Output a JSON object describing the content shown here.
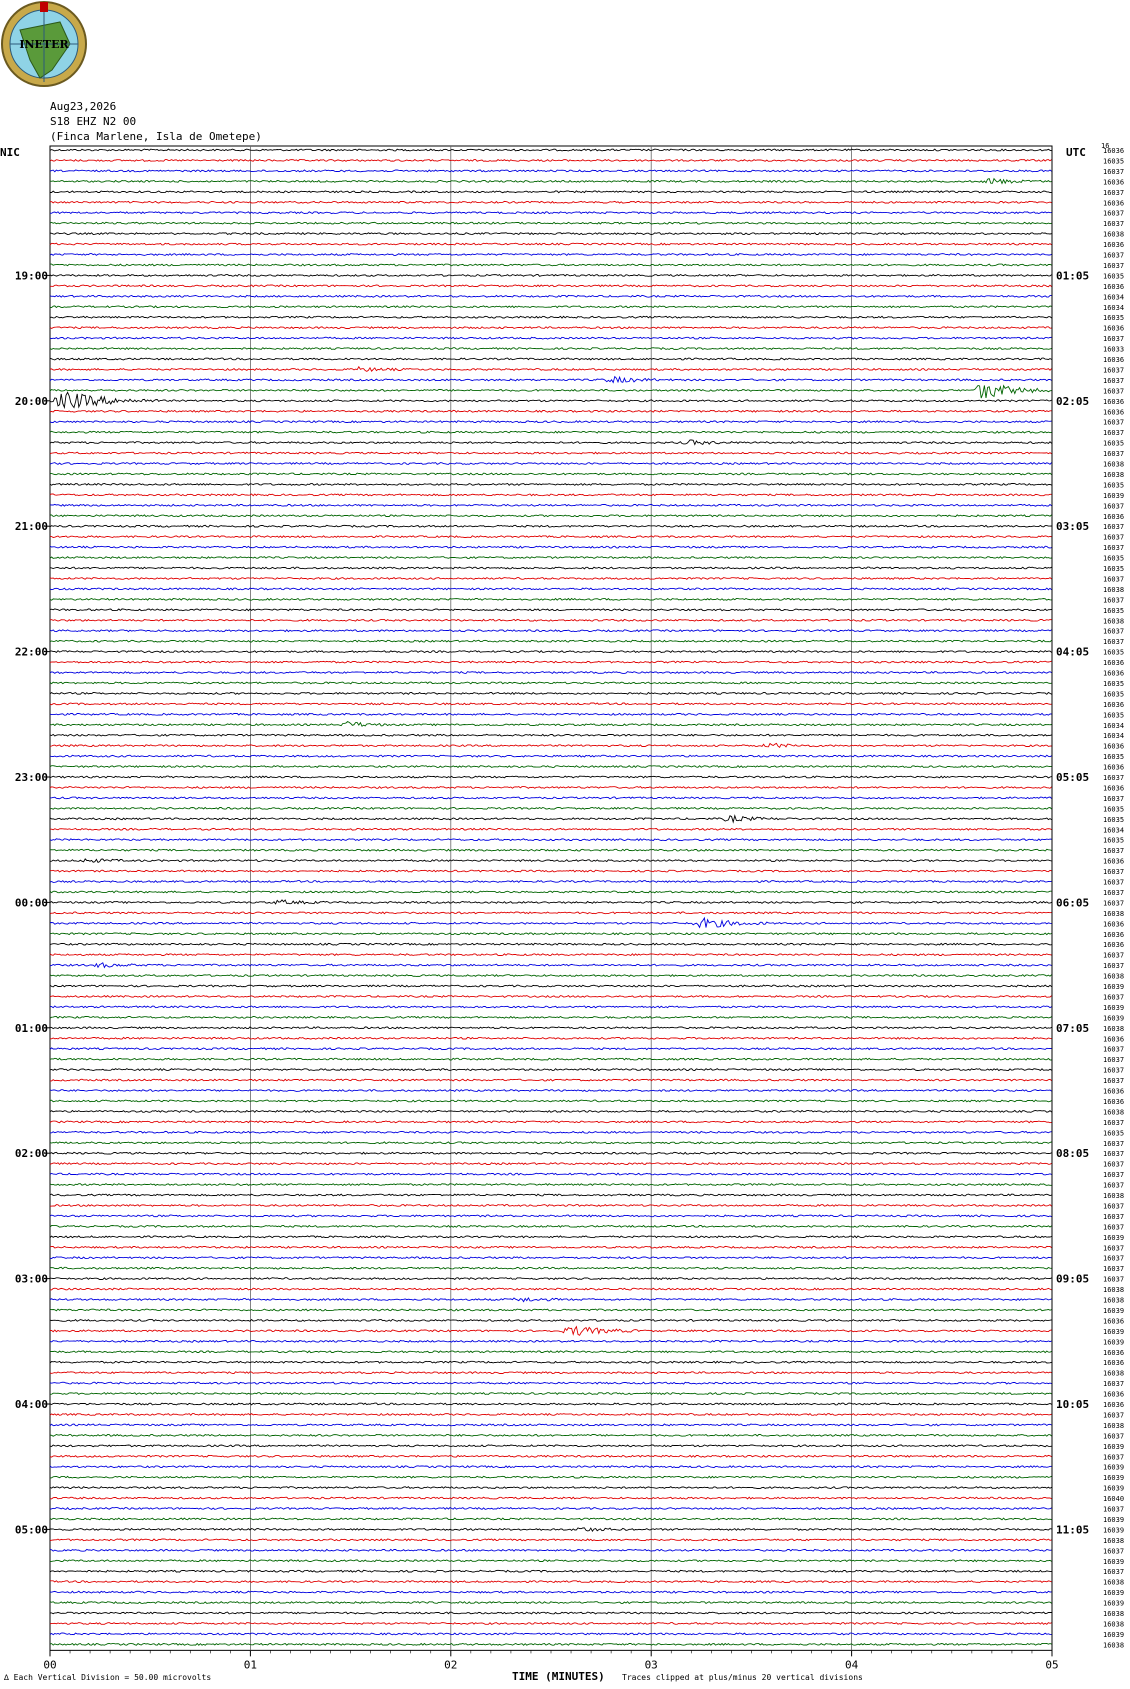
{
  "header": {
    "date": "Aug23,2026",
    "station": "S18 EHZ N2 00",
    "location": "(Finca Marlene, Isla de Ometepe)",
    "left_timezone": "NIC",
    "right_timezone": "UTC",
    "logo_text": "INETER"
  },
  "footer": {
    "division_note": "Each Vertical Division =    50.00 microvolts",
    "clip_note": "Traces clipped at plus/minus 20 vertical divisions",
    "corner_mark": "∆"
  },
  "colors": {
    "trace_cycle": [
      "#000000",
      "#e00000",
      "#0000e0",
      "#006400"
    ],
    "grid": "#000000"
  },
  "chart_data": {
    "type": "line",
    "title": "",
    "xlabel": "TIME (MINUTES)",
    "ylabel": "",
    "x_ticks": [
      "00",
      "01",
      "02",
      "03",
      "04",
      "05"
    ],
    "xlim": [
      0,
      5
    ],
    "rows_per_hour": 12,
    "row_count": 144,
    "left_hour_labels": [
      "19:00",
      "20:00",
      "21:00",
      "22:00",
      "23:00",
      "00:00",
      "01:00",
      "02:00",
      "03:00",
      "04:00",
      "05:00"
    ],
    "right_hour_labels": [
      "01:05",
      "02:05",
      "03:05",
      "04:05",
      "05:05",
      "06:05",
      "07:05",
      "08:05",
      "09:05",
      "10:05",
      "11:05"
    ],
    "first_labeled_row": 12,
    "right_top_label": "16",
    "row_values": [
      "16036",
      "16035",
      "16037",
      "16036",
      "16037",
      "16036",
      "16037",
      "16037",
      "16038",
      "16036",
      "16037",
      "16037",
      "16035",
      "16036",
      "16034",
      "16034",
      "16035",
      "16036",
      "16037",
      "16033",
      "16036",
      "16037",
      "16037",
      "16037",
      "16036",
      "16036",
      "16037",
      "16037",
      "16035",
      "16037",
      "16038",
      "16038",
      "16035",
      "16039",
      "16037",
      "16036",
      "16037",
      "16037",
      "16037",
      "16035",
      "16035",
      "16037",
      "16038",
      "16037",
      "16035",
      "16038",
      "16037",
      "16037",
      "16035",
      "16036",
      "16036",
      "16035",
      "16035",
      "16036",
      "16035",
      "16034",
      "16034",
      "16036",
      "16035",
      "16036",
      "16037",
      "16036",
      "16037",
      "16035",
      "16035",
      "16034",
      "16035",
      "16037",
      "16036",
      "16037",
      "16037",
      "16037",
      "16037",
      "16038",
      "16036",
      "16036",
      "16036",
      "16037",
      "16037",
      "16038",
      "16039",
      "16037",
      "16039",
      "16039",
      "16038",
      "16036",
      "16037",
      "16037",
      "16037",
      "16037",
      "16036",
      "16036",
      "16038",
      "16037",
      "16035",
      "16037",
      "16037",
      "16037",
      "16037",
      "16037",
      "16038",
      "16037",
      "16037",
      "16037",
      "16039",
      "16037",
      "16037",
      "16037",
      "16037",
      "16038",
      "16038",
      "16039",
      "16036",
      "16039",
      "16039",
      "16036",
      "16036",
      "16038",
      "16037",
      "16036",
      "16036",
      "16037",
      "16038",
      "16037",
      "16039",
      "16037",
      "16039",
      "16039",
      "16039",
      "16040",
      "16037",
      "16039",
      "16039",
      "16038",
      "16037",
      "16039",
      "16037",
      "16038",
      "16039",
      "16039",
      "16038",
      "16038",
      "16039",
      "16038"
    ],
    "events": [
      {
        "row": 3,
        "minute": 4.65,
        "duration": 0.3,
        "amplitude": 3
      },
      {
        "row": 21,
        "minute": 1.5,
        "duration": 0.3,
        "amplitude": 2
      },
      {
        "row": 22,
        "minute": 2.75,
        "duration": 0.35,
        "amplitude": 3
      },
      {
        "row": 23,
        "minute": 4.6,
        "duration": 0.4,
        "amplitude": 9
      },
      {
        "row": 24,
        "minute": 0.0,
        "duration": 0.55,
        "amplitude": 9
      },
      {
        "row": 28,
        "minute": 3.15,
        "duration": 0.3,
        "amplitude": 2
      },
      {
        "row": 55,
        "minute": 1.45,
        "duration": 0.25,
        "amplitude": 3
      },
      {
        "row": 57,
        "minute": 3.55,
        "duration": 0.3,
        "amplitude": 2
      },
      {
        "row": 64,
        "minute": 3.35,
        "duration": 0.3,
        "amplitude": 3
      },
      {
        "row": 68,
        "minute": 0.15,
        "duration": 0.25,
        "amplitude": 2
      },
      {
        "row": 72,
        "minute": 1.1,
        "duration": 0.3,
        "amplitude": 2
      },
      {
        "row": 74,
        "minute": 3.2,
        "duration": 0.4,
        "amplitude": 5
      },
      {
        "row": 78,
        "minute": 0.2,
        "duration": 0.3,
        "amplitude": 2
      },
      {
        "row": 110,
        "minute": 2.3,
        "duration": 0.3,
        "amplitude": 2
      },
      {
        "row": 113,
        "minute": 2.55,
        "duration": 0.4,
        "amplitude": 5
      },
      {
        "row": 132,
        "minute": 2.6,
        "duration": 0.3,
        "amplitude": 2
      }
    ]
  }
}
